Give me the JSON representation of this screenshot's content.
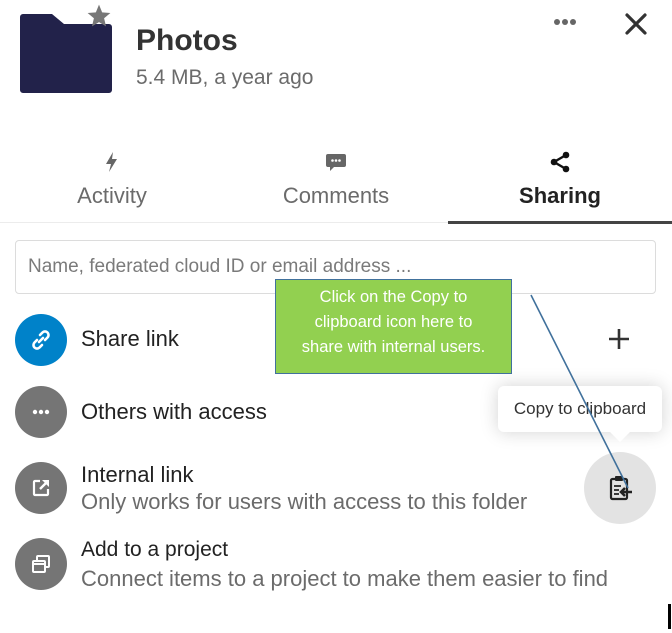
{
  "header": {
    "title": "Photos",
    "subtitle": "5.4 MB, a year ago",
    "icons": {
      "folder": "folder-icon",
      "favorite": "star-icon",
      "more": "more-icon",
      "close": "close-icon"
    }
  },
  "tabs": [
    {
      "label": "Activity",
      "icon": "lightning-icon",
      "active": false
    },
    {
      "label": "Comments",
      "icon": "comment-icon",
      "active": false
    },
    {
      "label": "Sharing",
      "icon": "share-icon",
      "active": true
    }
  ],
  "search": {
    "value": "",
    "placeholder": "Name, federated cloud ID or email address ..."
  },
  "share_items": [
    {
      "title": "Share link",
      "subtitle": "",
      "icon": "link-icon",
      "color": "#0082c9",
      "action": "add-icon"
    },
    {
      "title": "Others with access",
      "subtitle": "",
      "icon": "dots-icon",
      "color": "#757575"
    },
    {
      "title": "Internal link",
      "subtitle": "Only works for users with access to this folder",
      "icon": "external-link-icon",
      "color": "#757575",
      "action": "clipboard-icon"
    },
    {
      "title": "Add to a project",
      "subtitle": "Connect items to a project to make them easier to find",
      "icon": "project-icon",
      "color": "#757575"
    }
  ],
  "tooltip": {
    "text": "Copy to clipboard"
  },
  "callout": {
    "lines": [
      "Click on the Copy to",
      "clipboard icon here to",
      "share with internal users."
    ],
    "fill": "#92d050",
    "border": "#41719c"
  },
  "colors": {
    "folder": "#22224a",
    "primary": "#0082c9",
    "muted_avatar": "#757575"
  }
}
